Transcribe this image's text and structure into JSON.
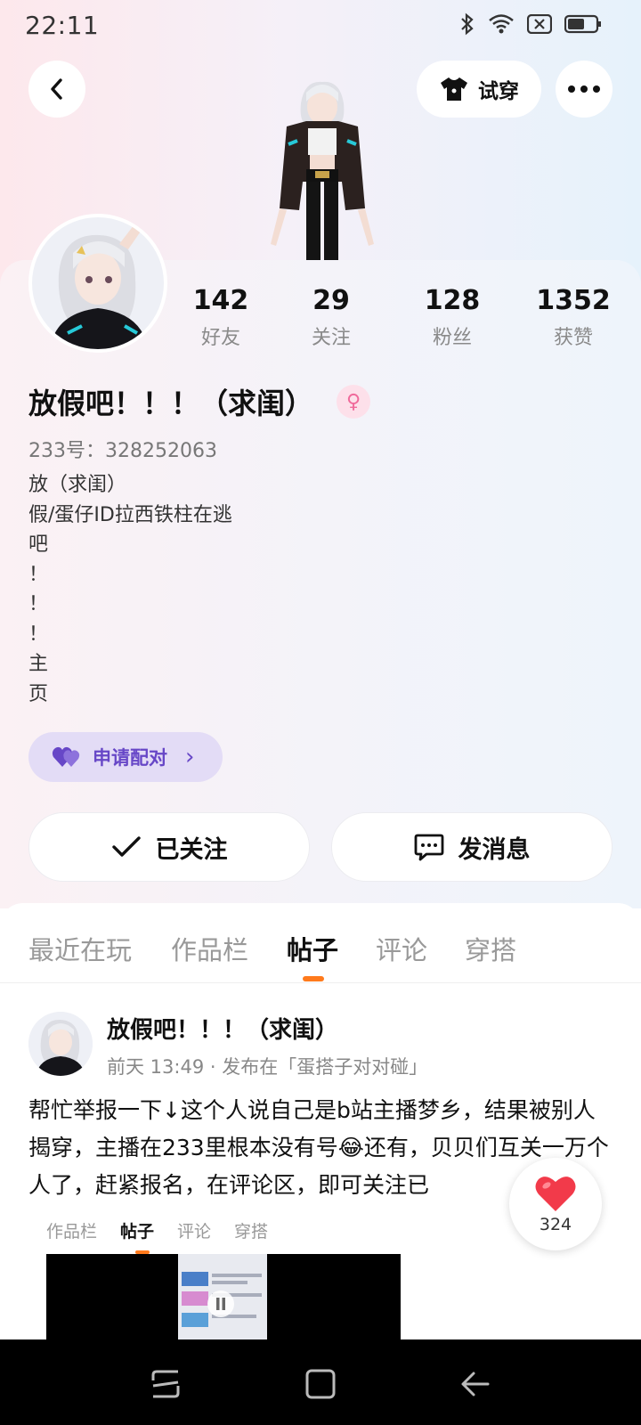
{
  "status_bar": {
    "time": "22:11"
  },
  "header": {
    "tryon_label": "试穿"
  },
  "stats": [
    {
      "value": "142",
      "label": "好友"
    },
    {
      "value": "29",
      "label": "关注"
    },
    {
      "value": "128",
      "label": "粉丝"
    },
    {
      "value": "1352",
      "label": "获赞"
    }
  ],
  "profile": {
    "name": "放假吧！！！（求闺）",
    "gender_symbol": "♀",
    "uid": "233号：328252063",
    "bio_lines": [
      "放（求闺）",
      "假/蛋仔ID拉西铁柱在逃",
      "吧",
      "！",
      "！",
      "！",
      "主",
      "页"
    ]
  },
  "pair_button": {
    "label": "申请配对",
    "arrow": "›"
  },
  "actions": {
    "followed_label": "已关注",
    "message_label": "发消息"
  },
  "tabs": [
    {
      "label": "最近在玩"
    },
    {
      "label": "作品栏"
    },
    {
      "label": "帖子",
      "active": true
    },
    {
      "label": "评论"
    },
    {
      "label": "穿搭"
    }
  ],
  "post": {
    "author": "放假吧！！！（求闺）",
    "meta": "前天 13:49 · 发布在「蛋搭子对对碰」",
    "text": "帮忙举报一下↓这个人说自己是b站主播梦乡，结果被别人揭穿，主播在233里根本没有号😂还有，贝贝们互关一万个人了，赶紧报名，在评论区，即可关注已",
    "mini_tabs": [
      "作品栏",
      "帖子",
      "评论",
      "穿搭"
    ],
    "like_count": "324"
  },
  "colors": {
    "accent_orange": "#ff7a1c",
    "pair_purple": "#6747c7",
    "like_red": "#f23a4a"
  }
}
